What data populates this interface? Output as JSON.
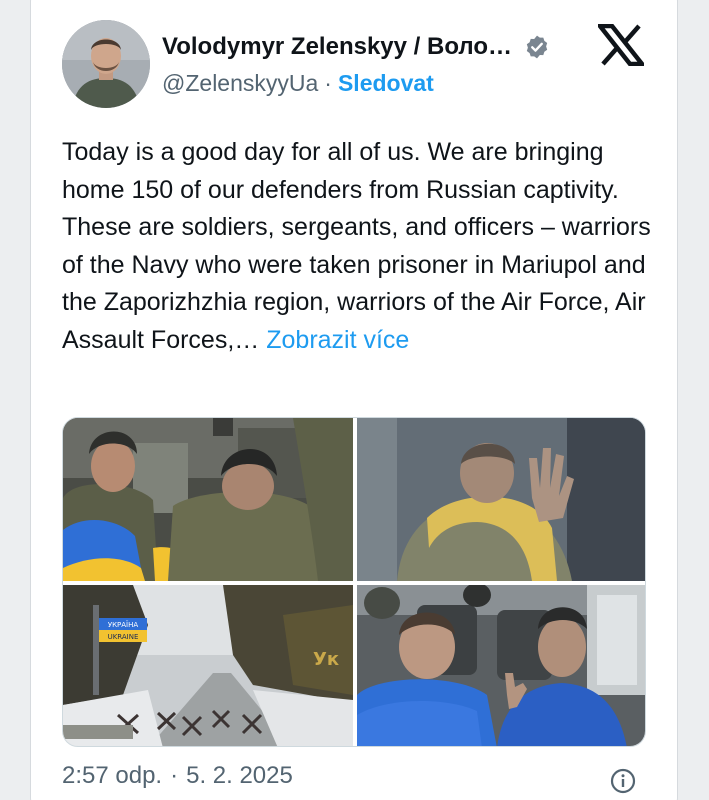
{
  "tweet": {
    "author_name": "Volodymyr Zelenskyy / Воло…",
    "handle": "@ZelenskyyUa",
    "separator": "·",
    "follow_label": "Sledovat",
    "text": "Today is a good day for all of us. We are bringing home 150 of our defenders from Russian captivity. These are soldiers, sergeants, and officers – warriors of the Navy who were taken prisoner in Mariupol and the Zaporizhzhia region, warriors of the Air Force, Air Assault Forces,… ",
    "show_more_label": "Zobrazit více",
    "time": "2:57 odp.",
    "date": "5. 2. 2025"
  },
  "media": {
    "photo_count": 4,
    "sign_text_1": "УКРАЇНА",
    "sign_text_2": "UKRAINE"
  },
  "icons": {
    "verified": "verified-badge-icon",
    "logo": "x-logo-icon",
    "info": "info-icon"
  },
  "colors": {
    "accent": "#1d9bf0",
    "text": "#0f1419",
    "muted": "#536471",
    "flag_blue": "#2f6fd6",
    "flag_yellow": "#f2c230"
  }
}
